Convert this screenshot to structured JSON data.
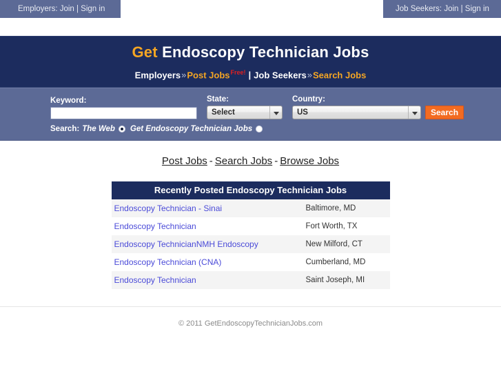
{
  "topbar": {
    "employers": "Employers: Join | Sign in",
    "jobseekers": "Job Seekers: Join | Sign in"
  },
  "header": {
    "title_accent": "Get",
    "title_rest": " Endoscopy Technician Jobs",
    "subnav": {
      "employers_label": "Employers",
      "arrow1": "»",
      "post_jobs": "Post Jobs",
      "free_badge": "Free!",
      "pipe": "|",
      "jobseekers_label": "Job Seekers",
      "arrow2": "»",
      "search_jobs": "Search Jobs"
    }
  },
  "search": {
    "keyword_label": "Keyword:",
    "keyword_value": "",
    "keyword_placeholder": "",
    "state_label": "State:",
    "state_value": "Select",
    "state_options": [
      "Select"
    ],
    "country_label": "Country:",
    "country_value": "US",
    "country_options": [
      "US"
    ],
    "search_button": "Search",
    "scope_label": "Search:",
    "scope_web": "The Web",
    "scope_site": "Get Endoscopy Technician Jobs",
    "scope_selected": "The Web"
  },
  "midlinks": {
    "post_jobs": "Post Jobs",
    "dash1": "-",
    "search_jobs": "Search Jobs",
    "dash2": "-",
    "browse_jobs": "Browse Jobs"
  },
  "jobs": {
    "heading": "Recently Posted Endoscopy Technician Jobs",
    "rows": [
      {
        "title": "Endoscopy Technician - Sinai",
        "location": "Baltimore, MD"
      },
      {
        "title": "Endoscopy Technician",
        "location": "Fort Worth, TX"
      },
      {
        "title": "Endoscopy TechnicianNMH Endoscopy",
        "location": "New Milford, CT"
      },
      {
        "title": "Endoscopy Technician (CNA)",
        "location": "Cumberland, MD"
      },
      {
        "title": "Endoscopy Technician",
        "location": "Saint Joseph, MI"
      }
    ]
  },
  "footer": {
    "copyright": "© 2011 GetEndoscopyTechnicianJobs.com"
  },
  "colors": {
    "navy": "#1c2c5e",
    "slate": "#5c6a96",
    "orange_accent": "#f5a623",
    "button_orange": "#f26b21",
    "link_blue": "#4a4ad8",
    "free_red": "#e02020"
  }
}
